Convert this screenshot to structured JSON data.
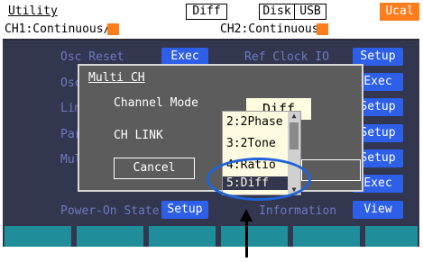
{
  "header": {
    "title": "Utility",
    "diff_label": "Diff",
    "disk_label": "Disk",
    "usb_label": "USB",
    "ucal_label": "Ucal",
    "ch1": "CH1:Continuous/",
    "ch2": "CH2:Continuous/"
  },
  "menu": {
    "osc_reset": "Osc Reset",
    "osc": "Osc",
    "limi": "Limi",
    "para": "Para",
    "mult": "Mult",
    "ref_clock": "Ref Clock IO",
    "power_on": "Power-On State",
    "information": "Information"
  },
  "buttons": {
    "exec1": "Exec",
    "setup_right1": "Setup",
    "exec_right2": "Exec",
    "setup_right3": "Setup",
    "setup_right4": "Setup",
    "setup_right5": "Setup",
    "exec_right6": "Exec",
    "power_on_setup": "Setup",
    "view": "View"
  },
  "dialog": {
    "title": "Multi CH",
    "channel_mode_label": "Channel Mode",
    "channel_mode_value": "Diff",
    "ch_link_label": "CH LINK",
    "cancel_label": "Cancel"
  },
  "dropdown": {
    "items": [
      "2:2Phase",
      "3:2Tone",
      "4:Ratio",
      "5:Diff"
    ],
    "selected_index": 3
  },
  "colors": {
    "screen_bg": "#33364f",
    "accent_orange": "#ff7d1c",
    "button_blue": "#2d5fe8",
    "menu_text": "#6b7ac0",
    "softkey_teal": "#1f8e9a",
    "highlight_ellipse": "#1f64d8"
  }
}
